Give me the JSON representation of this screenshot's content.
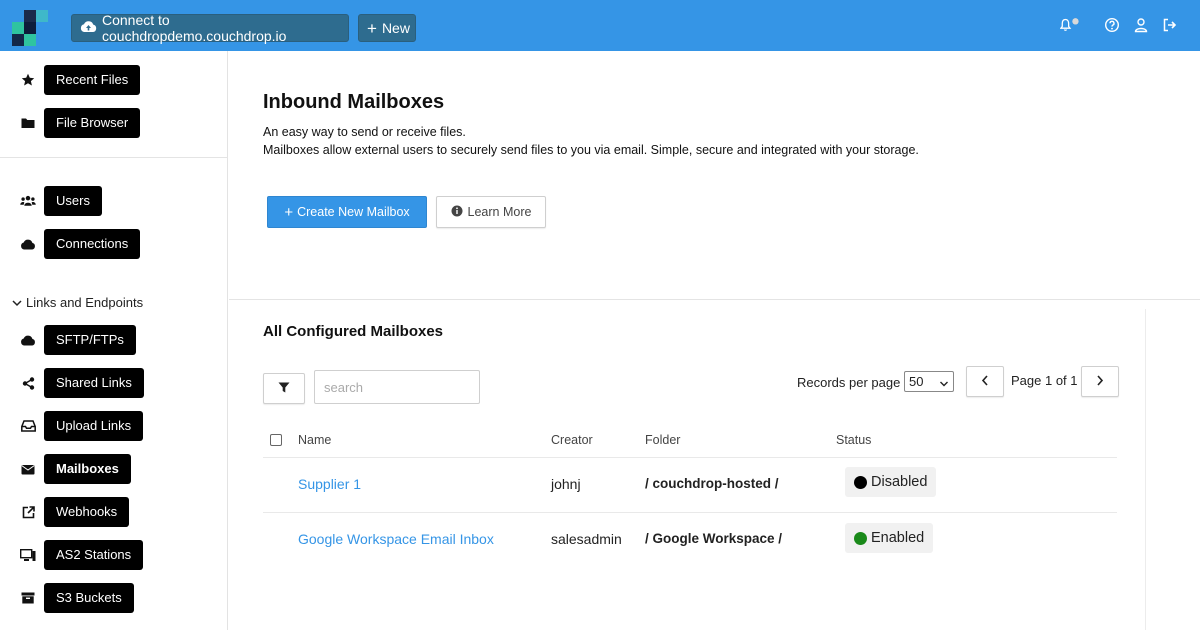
{
  "topbar": {
    "connect_label": "Connect to couchdropdemo.couchdrop.io",
    "new_label": "New",
    "icons": [
      "cloud-upload-icon",
      "plus-icon",
      "bell-icon",
      "help-icon",
      "user-icon",
      "logout-icon"
    ]
  },
  "sidebar": {
    "items": [
      {
        "label": "Recent Files",
        "icon": "star-icon"
      },
      {
        "label": "File Browser",
        "icon": "folder-icon"
      },
      {
        "label": "Users",
        "icon": "users-icon"
      },
      {
        "label": "Connections",
        "icon": "cloud-icon"
      },
      {
        "label": "SFTP/FTPs",
        "icon": "cloud-icon"
      },
      {
        "label": "Shared Links",
        "icon": "share-icon"
      },
      {
        "label": "Upload Links",
        "icon": "inbox-icon"
      },
      {
        "label": "Mailboxes",
        "icon": "envelope-icon",
        "active": true
      },
      {
        "label": "Webhooks",
        "icon": "external-link-icon"
      },
      {
        "label": "AS2 Stations",
        "icon": "desktop-icon"
      },
      {
        "label": "S3 Buckets",
        "icon": "archive-icon"
      }
    ],
    "section_label": "Links and Endpoints"
  },
  "main": {
    "title": "Inbound Mailboxes",
    "description_line1": "An easy way to send or receive files.",
    "description_line2": "Mailboxes allow external users to securely send files to you via email. Simple, secure and integrated with your storage.",
    "create_label": "Create New Mailbox",
    "learn_more_label": "Learn More",
    "section_title": "All Configured Mailboxes",
    "search_placeholder": "search",
    "records_per_page_label": "Records per page",
    "records_per_page_value": "50",
    "page_label": "Page 1 of 1",
    "table": {
      "headers": {
        "name": "Name",
        "creator": "Creator",
        "folder": "Folder",
        "status": "Status"
      },
      "rows": [
        {
          "name": "Supplier 1",
          "creator": "johnj",
          "folder": "/ couchdrop-hosted /",
          "status": "Disabled",
          "status_color": "#000000"
        },
        {
          "name": "Google Workspace Email Inbox",
          "creator": "salesadmin",
          "folder": "/ Google Workspace /",
          "status": "Enabled",
          "status_color": "#1a8a1a"
        }
      ]
    }
  },
  "colors": {
    "accent": "#3595e6",
    "topbar_button": "#2e6c8f",
    "enabled": "#1a8a1a",
    "disabled": "#000000"
  }
}
